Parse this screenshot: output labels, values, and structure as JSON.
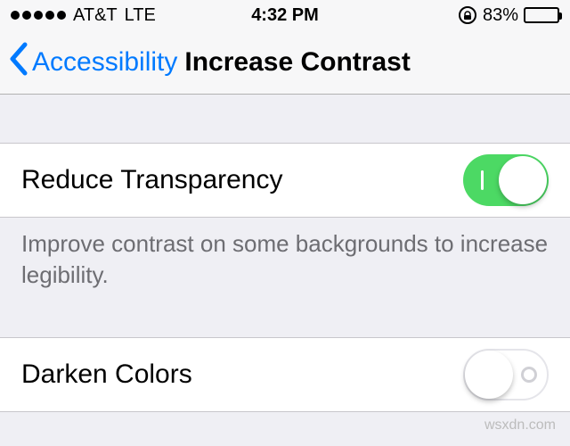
{
  "status": {
    "carrier": "AT&T",
    "network": "LTE",
    "time": "4:32 PM",
    "battery_pct": "83%"
  },
  "nav": {
    "back_label": "Accessibility",
    "title": "Increase Contrast"
  },
  "rows": {
    "reduce_transparency": {
      "label": "Reduce Transparency",
      "on": true
    },
    "footer": "Improve contrast on some backgrounds to increase legibility.",
    "darken_colors": {
      "label": "Darken Colors",
      "on": false
    }
  },
  "watermark": "wsxdn.com"
}
